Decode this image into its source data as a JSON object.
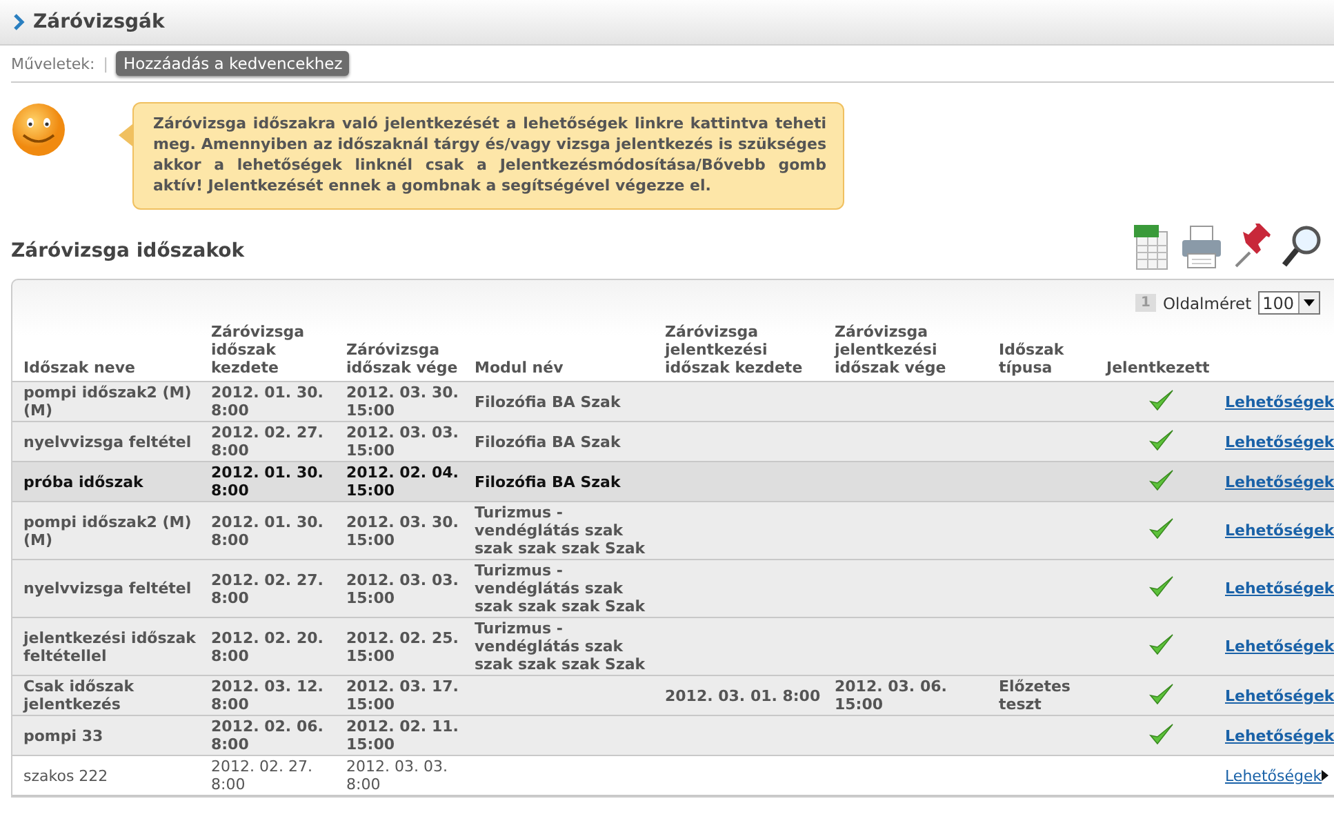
{
  "header": {
    "title": "Záróvizsgák"
  },
  "actions": {
    "label": "Műveletek:",
    "separator": "|",
    "buttons": [
      "Hozzáadás a kedvencekhez"
    ]
  },
  "notice": {
    "text": "Záróvizsga időszakra való jelentkezését a lehetőségek linkre kattintva teheti meg. Amennyiben az időszaknál tárgy és/vagy vizsga jelentkezés is szükséges akkor a lehetőségek linknél csak a Jelentkezésmódosítása/Bővebb gomb aktív! Jelentkezését ennek a gombnak a segítségével végezze el."
  },
  "section": {
    "title": "Záróvizsga időszakok"
  },
  "pager": {
    "pages": [
      {
        "label": "1",
        "selected": true
      }
    ],
    "page_size_label": "Oldalméret",
    "page_size": "100"
  },
  "table": {
    "columns": [
      "Időszak neve",
      "Záróvizsga időszak kezdete",
      "Záróvizsga időszak vége",
      "Modul név",
      "Záróvizsga jelentkezési időszak kezdete",
      "Záróvizsga jelentkezési időszak vége",
      "Időszak típusa",
      "Jelentkezett"
    ],
    "rows": [
      {
        "cells": [
          "pompi időszak2 (M) (M)",
          "2012. 01. 30. 8:00",
          "2012. 03. 30. 15:00",
          "Filozófia BA Szak",
          "",
          "",
          "",
          ""
        ],
        "registered": true,
        "selected": false,
        "link": "Lehetőségek"
      },
      {
        "cells": [
          "nyelvvizsga feltétel",
          "2012. 02. 27. 8:00",
          "2012. 03. 03. 15:00",
          "Filozófia BA Szak",
          "",
          "",
          "",
          ""
        ],
        "registered": true,
        "selected": false,
        "link": "Lehetőségek"
      },
      {
        "cells": [
          "próba időszak",
          "2012. 01. 30. 8:00",
          "2012. 02. 04. 15:00",
          "Filozófia BA Szak",
          "",
          "",
          "",
          ""
        ],
        "registered": true,
        "selected": true,
        "link": "Lehetőségek"
      },
      {
        "cells": [
          "pompi időszak2 (M) (M)",
          "2012. 01. 30. 8:00",
          "2012. 03. 30. 15:00",
          "Turizmus - vendéglátás szak szak szak szak Szak",
          "",
          "",
          "",
          ""
        ],
        "registered": true,
        "selected": false,
        "link": "Lehetőségek"
      },
      {
        "cells": [
          "nyelvvizsga feltétel",
          "2012. 02. 27. 8:00",
          "2012. 03. 03. 15:00",
          "Turizmus - vendéglátás szak szak szak szak Szak",
          "",
          "",
          "",
          ""
        ],
        "registered": true,
        "selected": false,
        "link": "Lehetőségek"
      },
      {
        "cells": [
          "jelentkezési időszak feltétellel",
          "2012. 02. 20. 8:00",
          "2012. 02. 25. 15:00",
          "Turizmus - vendéglátás szak szak szak szak Szak",
          "",
          "",
          "",
          ""
        ],
        "registered": true,
        "selected": false,
        "link": "Lehetőségek"
      },
      {
        "cells": [
          "Csak időszak jelentkezés",
          "2012. 03. 12. 8:00",
          "2012. 03. 17. 15:00",
          "",
          "2012. 03. 01. 8:00",
          "2012. 03. 06. 15:00",
          "Előzetes teszt",
          ""
        ],
        "registered": true,
        "selected": false,
        "link": "Lehetőségek"
      },
      {
        "cells": [
          "pompi 33",
          "2012. 02. 06. 8:00",
          "2012. 02. 11. 15:00",
          "",
          "",
          "",
          "",
          ""
        ],
        "registered": true,
        "selected": false,
        "link": "Lehetőségek"
      },
      {
        "cells": [
          "szakos 222",
          "2012. 02. 27. 8:00",
          "2012. 03. 03. 8:00",
          "",
          "",
          "",
          "",
          ""
        ],
        "registered": false,
        "selected": false,
        "link": "Lehetőségek"
      }
    ]
  }
}
